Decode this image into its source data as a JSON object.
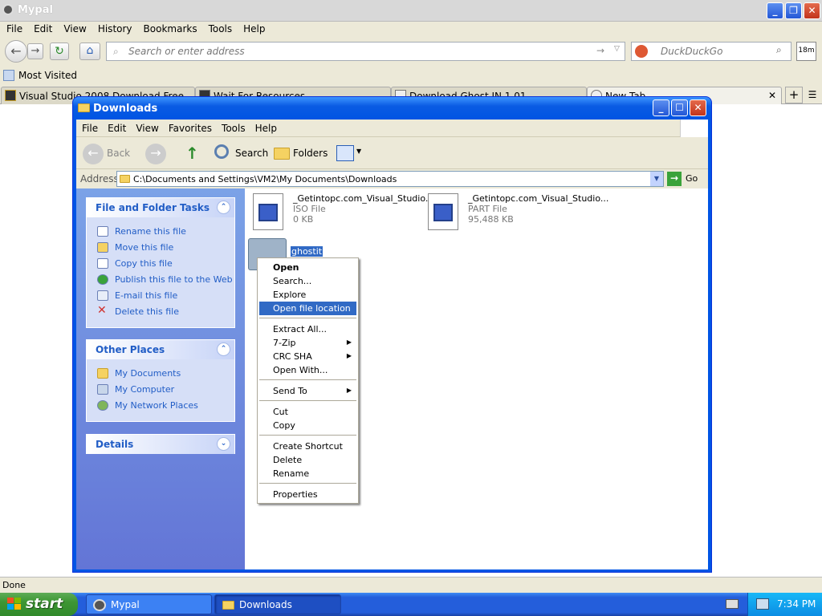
{
  "browser": {
    "title": "Mypal",
    "menu": [
      "File",
      "Edit",
      "View",
      "History",
      "Bookmarks",
      "Tools",
      "Help"
    ],
    "url_placeholder": "Search or enter address",
    "search_placeholder": "DuckDuckGo",
    "badge": "18m",
    "bookmark": "Most Visited",
    "tabs": [
      {
        "label": "Visual Studio 2008 Download Free"
      },
      {
        "label": "Wait For Resources"
      },
      {
        "label": "Download Ghost IN 1.01"
      },
      {
        "label": "New Tab"
      }
    ],
    "status": "Done"
  },
  "explorer": {
    "title": "Downloads",
    "menu": [
      "File",
      "Edit",
      "View",
      "Favorites",
      "Tools",
      "Help"
    ],
    "toolbar": {
      "back": "Back",
      "search": "Search",
      "folders": "Folders"
    },
    "address_label": "Address",
    "address": "C:\\Documents and Settings\\VM2\\My Documents\\Downloads",
    "go": "Go",
    "tasks": {
      "title": "File and Folder Tasks",
      "items": [
        "Rename this file",
        "Move this file",
        "Copy this file",
        "Publish this file to the Web",
        "E-mail this file",
        "Delete this file"
      ]
    },
    "other": {
      "title": "Other Places",
      "items": [
        "My Documents",
        "My Computer",
        "My Network Places"
      ]
    },
    "details": {
      "title": "Details"
    },
    "files": [
      {
        "name": "_Getintopc.com_Visual_Studio...",
        "type": "ISO File",
        "size": "0 KB"
      },
      {
        "name": "_Getintopc.com_Visual_Studio...",
        "type": "PART File",
        "size": "95,488 KB"
      },
      {
        "name": "ghostit"
      }
    ]
  },
  "context_menu": {
    "items": [
      "Open",
      "Search...",
      "Explore",
      "Open file location",
      "Extract All...",
      "7-Zip",
      "CRC SHA",
      "Open With...",
      "Send To",
      "Cut",
      "Copy",
      "Create Shortcut",
      "Delete",
      "Rename",
      "Properties"
    ],
    "selected": "Open file location"
  },
  "taskbar": {
    "start": "start",
    "buttons": [
      "Mypal",
      "Downloads"
    ],
    "time": "7:34 PM"
  }
}
